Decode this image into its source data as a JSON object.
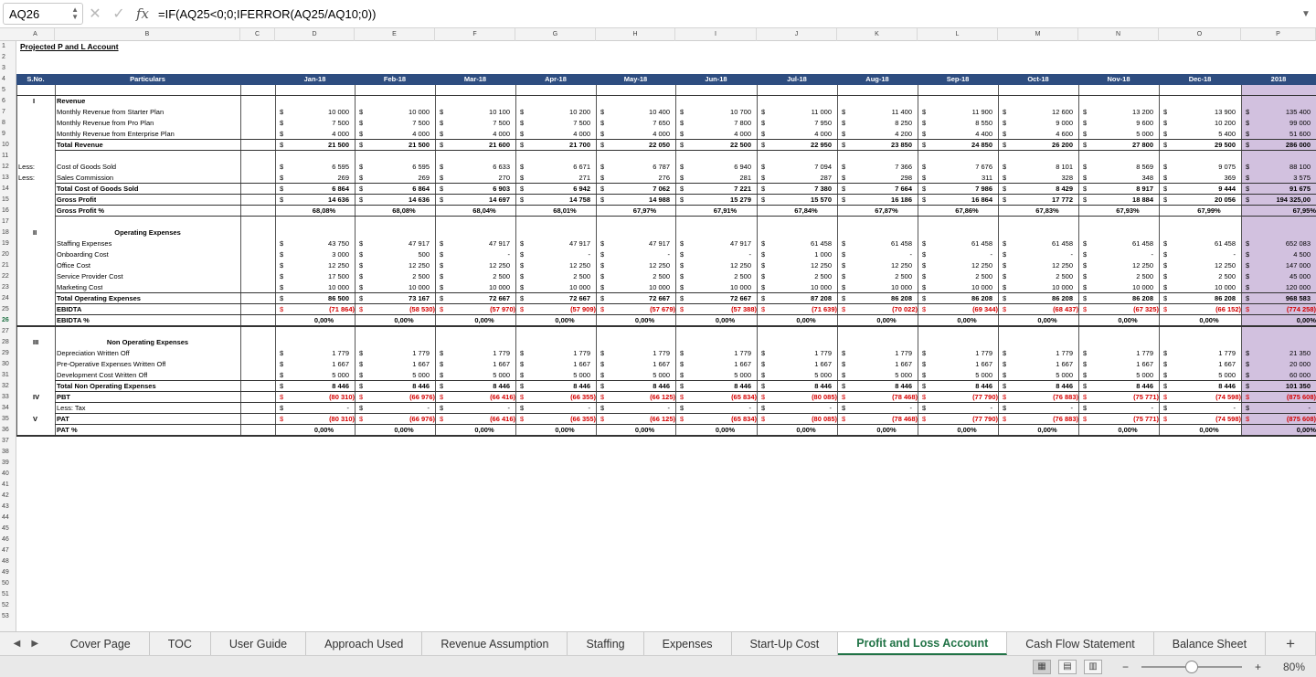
{
  "formula_bar": {
    "cell_ref": "AQ26",
    "fx": "fx",
    "cancel": "✕",
    "confirm": "✓",
    "formula": "=IF(AQ25<0;0;IFERROR(AQ25/AQ10;0))"
  },
  "columns": [
    "A",
    "B",
    "C",
    "D",
    "E",
    "F",
    "G",
    "H",
    "I",
    "J",
    "K",
    "L",
    "M",
    "N",
    "O",
    "P"
  ],
  "title": "Projected P and L Account",
  "headers": {
    "sno": "S.No.",
    "particulars": "Particulars",
    "months": [
      "Jan-18",
      "Feb-18",
      "Mar-18",
      "Apr-18",
      "May-18",
      "Jun-18",
      "Jul-18",
      "Aug-18",
      "Sep-18",
      "Oct-18",
      "Nov-18",
      "Dec-18",
      "2018"
    ]
  },
  "currency": "$",
  "rows": [
    {
      "r": 6,
      "sno": "I",
      "label": "Revenue",
      "bold": true
    },
    {
      "r": 7,
      "label": "Monthly Revenue from Starter Plan",
      "vals": [
        "10 000",
        "10 000",
        "10 100",
        "10 200",
        "10 400",
        "10 700",
        "11 000",
        "11 400",
        "11 900",
        "12 600",
        "13 200",
        "13 900",
        "135 400"
      ]
    },
    {
      "r": 8,
      "label": "Monthly Revenue from Pro Plan",
      "vals": [
        "7 500",
        "7 500",
        "7 500",
        "7 500",
        "7 650",
        "7 800",
        "7 950",
        "8 250",
        "8 550",
        "9 000",
        "9 600",
        "10 200",
        "99 000"
      ]
    },
    {
      "r": 9,
      "label": "Monthly Revenue from Enterprise Plan",
      "vals": [
        "4 000",
        "4 000",
        "4 000",
        "4 000",
        "4 000",
        "4 000",
        "4 000",
        "4 200",
        "4 400",
        "4 600",
        "5 000",
        "5 400",
        "51 600"
      ]
    },
    {
      "r": 10,
      "label": "Total Revenue",
      "bold": true,
      "vals": [
        "21 500",
        "21 500",
        "21 600",
        "21 700",
        "22 050",
        "22 500",
        "22 950",
        "23 850",
        "24 850",
        "26 200",
        "27 800",
        "29 500",
        "286 000"
      ]
    },
    {
      "r": 12,
      "sno": "Less:",
      "label": "Cost of Goods Sold",
      "vals": [
        "6 595",
        "6 595",
        "6 633",
        "6 671",
        "6 787",
        "6 940",
        "7 094",
        "7 366",
        "7 676",
        "8 101",
        "8 569",
        "9 075",
        "88 100"
      ]
    },
    {
      "r": 13,
      "sno": "Less:",
      "label": "Sales Commission",
      "vals": [
        "269",
        "269",
        "270",
        "271",
        "276",
        "281",
        "287",
        "298",
        "311",
        "328",
        "348",
        "369",
        "3 575"
      ]
    },
    {
      "r": 14,
      "label": "Total Cost of Goods Sold",
      "bold": true,
      "vals": [
        "6 864",
        "6 864",
        "6 903",
        "6 942",
        "7 062",
        "7 221",
        "7 380",
        "7 664",
        "7 986",
        "8 429",
        "8 917",
        "9 444",
        "91 675"
      ]
    },
    {
      "r": 15,
      "label": "Gross Profit",
      "bold": true,
      "vals": [
        "14 636",
        "14 636",
        "14 697",
        "14 758",
        "14 988",
        "15 279",
        "15 570",
        "16 186",
        "16 864",
        "17 772",
        "18 884",
        "20 056",
        "194 325,00"
      ]
    },
    {
      "r": 16,
      "label": "Gross Profit %",
      "bold": true,
      "pct": true,
      "vals": [
        "68,08%",
        "68,08%",
        "68,04%",
        "68,01%",
        "67,97%",
        "67,91%",
        "67,84%",
        "67,87%",
        "67,86%",
        "67,83%",
        "67,93%",
        "67,99%",
        "67,95%"
      ]
    },
    {
      "r": 18,
      "sno": "II",
      "label": "Operating Expenses",
      "bold": true,
      "center": true
    },
    {
      "r": 19,
      "label": "Staffing Expenses",
      "vals": [
        "43 750",
        "47 917",
        "47 917",
        "47 917",
        "47 917",
        "47 917",
        "61 458",
        "61 458",
        "61 458",
        "61 458",
        "61 458",
        "61 458",
        "652 083"
      ]
    },
    {
      "r": 20,
      "label": "Onboarding Cost",
      "vals": [
        "3 000",
        "500",
        "-",
        "-",
        "-",
        "-",
        "1 000",
        "-",
        "-",
        "-",
        "-",
        "-",
        "4 500"
      ]
    },
    {
      "r": 21,
      "label": "Office Cost",
      "vals": [
        "12 250",
        "12 250",
        "12 250",
        "12 250",
        "12 250",
        "12 250",
        "12 250",
        "12 250",
        "12 250",
        "12 250",
        "12 250",
        "12 250",
        "147 000"
      ]
    },
    {
      "r": 22,
      "label": "Service Provider Cost",
      "vals": [
        "17 500",
        "2 500",
        "2 500",
        "2 500",
        "2 500",
        "2 500",
        "2 500",
        "2 500",
        "2 500",
        "2 500",
        "2 500",
        "2 500",
        "45 000"
      ]
    },
    {
      "r": 23,
      "label": "Marketing Cost",
      "vals": [
        "10 000",
        "10 000",
        "10 000",
        "10 000",
        "10 000",
        "10 000",
        "10 000",
        "10 000",
        "10 000",
        "10 000",
        "10 000",
        "10 000",
        "120 000"
      ]
    },
    {
      "r": 24,
      "label": "Total Operating Expenses",
      "bold": true,
      "vals": [
        "86 500",
        "73 167",
        "72 667",
        "72 667",
        "72 667",
        "72 667",
        "87 208",
        "86 208",
        "86 208",
        "86 208",
        "86 208",
        "86 208",
        "968 583"
      ]
    },
    {
      "r": 25,
      "label": "EBIDTA",
      "bold": true,
      "neg": true,
      "vals": [
        "(71 864)",
        "(58 530)",
        "(57 970)",
        "(57 909)",
        "(57 679)",
        "(57 388)",
        "(71 639)",
        "(70 022)",
        "(69 344)",
        "(68 437)",
        "(67 325)",
        "(66 152)",
        "(774 258)"
      ]
    },
    {
      "r": 26,
      "label": "EBIDTA %",
      "bold": true,
      "pct": true,
      "vals": [
        "0,00%",
        "0,00%",
        "0,00%",
        "0,00%",
        "0,00%",
        "0,00%",
        "0,00%",
        "0,00%",
        "0,00%",
        "0,00%",
        "0,00%",
        "0,00%",
        "0,00%"
      ]
    },
    {
      "r": 28,
      "sno": "III",
      "label": "Non Operating Expenses",
      "bold": true,
      "center": true
    },
    {
      "r": 29,
      "label": "Depreciation Written Off",
      "vals": [
        "1 779",
        "1 779",
        "1 779",
        "1 779",
        "1 779",
        "1 779",
        "1 779",
        "1 779",
        "1 779",
        "1 779",
        "1 779",
        "1 779",
        "21 350"
      ]
    },
    {
      "r": 30,
      "label": "Pre-Operative Expenses Written Off",
      "vals": [
        "1 667",
        "1 667",
        "1 667",
        "1 667",
        "1 667",
        "1 667",
        "1 667",
        "1 667",
        "1 667",
        "1 667",
        "1 667",
        "1 667",
        "20 000"
      ]
    },
    {
      "r": 31,
      "label": "Development Cost Written Off",
      "vals": [
        "5 000",
        "5 000",
        "5 000",
        "5 000",
        "5 000",
        "5 000",
        "5 000",
        "5 000",
        "5 000",
        "5 000",
        "5 000",
        "5 000",
        "60 000"
      ]
    },
    {
      "r": 32,
      "label": "Total Non Operating Expenses",
      "bold": true,
      "vals": [
        "8 446",
        "8 446",
        "8 446",
        "8 446",
        "8 446",
        "8 446",
        "8 446",
        "8 446",
        "8 446",
        "8 446",
        "8 446",
        "8 446",
        "101 350"
      ]
    },
    {
      "r": 33,
      "sno": "IV",
      "label": "PBT",
      "bold": true,
      "neg": true,
      "vals": [
        "(80 310)",
        "(66 976)",
        "(66 416)",
        "(66 355)",
        "(66 125)",
        "(65 834)",
        "(80 085)",
        "(78 468)",
        "(77 790)",
        "(76 883)",
        "(75 771)",
        "(74 598)",
        "(875 608)"
      ]
    },
    {
      "r": 34,
      "label": "Less: Tax",
      "vals": [
        "-",
        "-",
        "-",
        "-",
        "-",
        "-",
        "-",
        "-",
        "-",
        "-",
        "-",
        "-",
        "-"
      ]
    },
    {
      "r": 35,
      "sno": "V",
      "label": "PAT",
      "bold": true,
      "neg": true,
      "vals": [
        "(80 310)",
        "(66 976)",
        "(66 416)",
        "(66 355)",
        "(66 125)",
        "(65 834)",
        "(80 085)",
        "(78 468)",
        "(77 790)",
        "(76 883)",
        "(75 771)",
        "(74 598)",
        "(875 608)"
      ]
    },
    {
      "r": 36,
      "label": "PAT %",
      "bold": true,
      "pct": true,
      "vals": [
        "0,00%",
        "0,00%",
        "0,00%",
        "0,00%",
        "0,00%",
        "0,00%",
        "0,00%",
        "0,00%",
        "0,00%",
        "0,00%",
        "0,00%",
        "0,00%",
        "0,00%"
      ]
    }
  ],
  "selected_row": 26,
  "tabs": [
    "Cover Page",
    "TOC",
    "User Guide",
    "Approach Used",
    "Revenue Assumption",
    "Staffing",
    "Expenses",
    "Start-Up Cost",
    "Profit and Loss Account",
    "Cash Flow Statement",
    "Balance Sheet"
  ],
  "active_tab": "Profit and Loss Account",
  "add_tab": "+",
  "status": {
    "zoom": "80%",
    "minus": "−",
    "plus": "+"
  }
}
